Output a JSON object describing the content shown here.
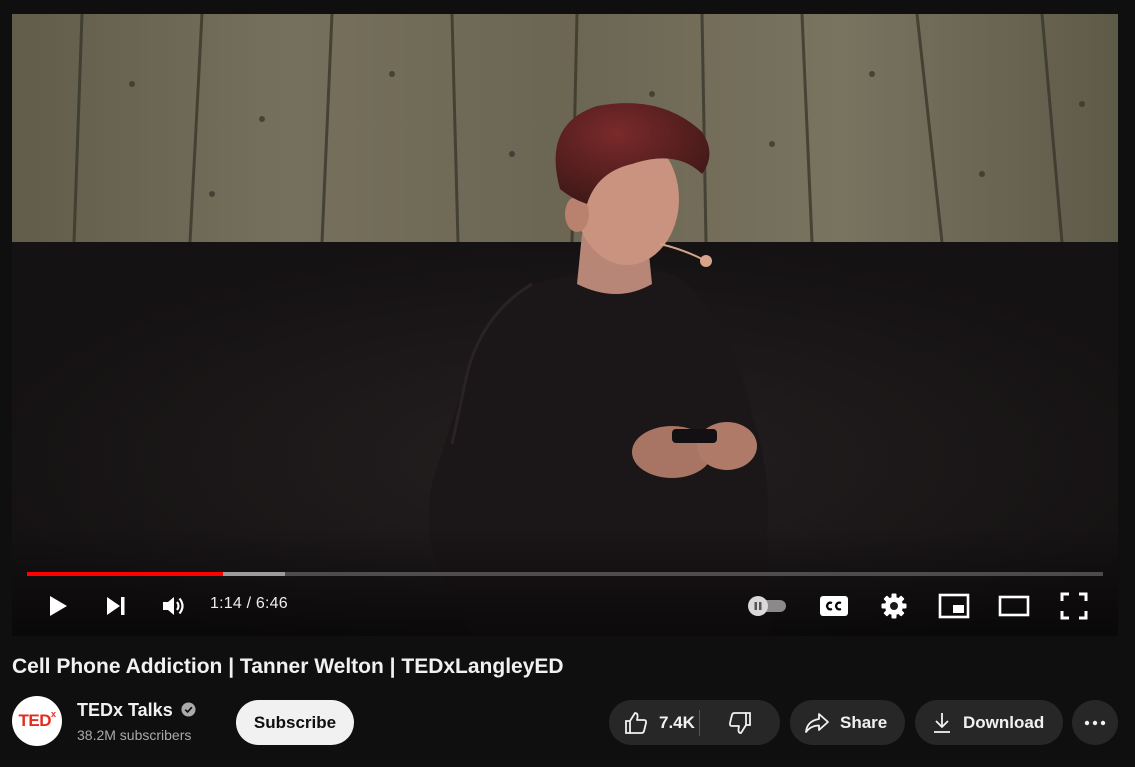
{
  "player": {
    "time_display": "1:14 / 6:46",
    "progress_played_fraction": 0.182,
    "progress_buffered_fraction": 0.24,
    "controls": {
      "play": "play-icon",
      "next": "next-icon",
      "volume": "volume-icon",
      "autoplay": "autoplay-toggle-icon",
      "captions": "cc-icon",
      "settings": "gear-icon",
      "miniplayer": "miniplayer-icon",
      "theater": "theater-mode-icon",
      "fullscreen": "fullscreen-icon"
    },
    "accent_color": "#ff0000"
  },
  "video": {
    "title": "Cell Phone Addiction | Tanner Welton | TEDxLangleyED"
  },
  "channel": {
    "avatar_text": "TED",
    "avatar_sup": "x",
    "name": "TEDx Talks",
    "subscribers": "38.2M subscribers",
    "verified_icon": "verified-check-icon",
    "brand_color": "#e62b1e"
  },
  "actions": {
    "subscribe_label": "Subscribe",
    "like_count": "7.4K",
    "share_label": "Share",
    "download_label": "Download",
    "more_icon": "more-horizontal-icon"
  }
}
